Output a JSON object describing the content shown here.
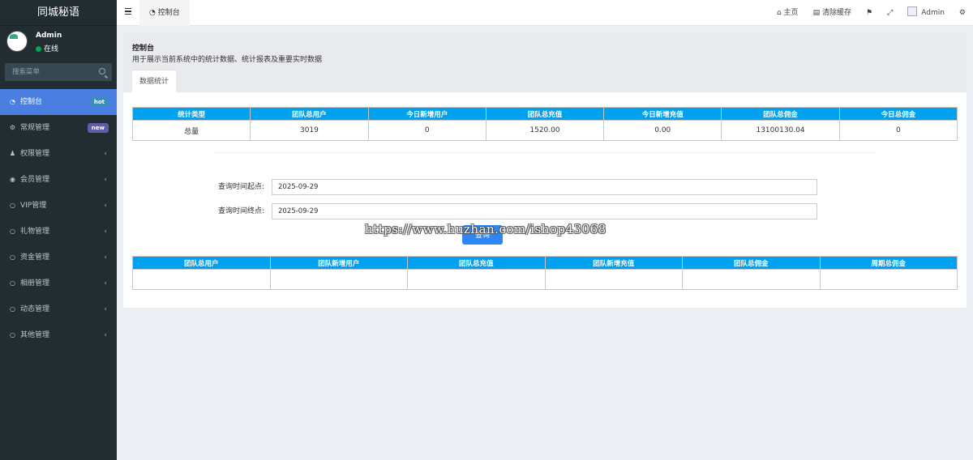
{
  "sidebar": {
    "app_title": "同城秘语",
    "user": {
      "name": "Admin",
      "status": "在线"
    },
    "search_placeholder": "搜索菜单",
    "items": [
      {
        "icon": "dashboard-icon",
        "label": "控制台",
        "badge": "hot",
        "active": true
      },
      {
        "icon": "gears-icon",
        "label": "常规管理",
        "badge": "new"
      },
      {
        "icon": "users-icon",
        "label": "权限管理"
      },
      {
        "icon": "user-circle-icon",
        "label": "会员管理"
      },
      {
        "icon": "circle-icon",
        "label": "VIP管理"
      },
      {
        "icon": "circle-icon",
        "label": "礼物管理"
      },
      {
        "icon": "circle-icon",
        "label": "资金管理"
      },
      {
        "icon": "circle-icon",
        "label": "相册管理"
      },
      {
        "icon": "circle-icon",
        "label": "动态管理"
      },
      {
        "icon": "circle-icon",
        "label": "其他管理"
      }
    ]
  },
  "header": {
    "tab_label": "控制台",
    "nav": {
      "home": "主页",
      "clear_cache": "清除缓存",
      "admin": "Admin"
    }
  },
  "content_header": {
    "title": "控制台",
    "description": "用于展示当前系统中的统计数据、统计报表及重要实时数据"
  },
  "tabs": {
    "stats": "数据统计"
  },
  "stats_table": {
    "headers": [
      "统计类型",
      "团队总用户",
      "今日新增用户",
      "团队总充值",
      "今日新增充值",
      "团队总佣金",
      "今日总佣金"
    ],
    "row": [
      "总量",
      "3019",
      "0",
      "1520.00",
      "0.00",
      "13100130.04",
      "0"
    ]
  },
  "query_form": {
    "start_label": "查询时间起点:",
    "start_value": "2025-09-29",
    "end_label": "查询时间终点:",
    "end_value": "2025-09-29",
    "button": "查询"
  },
  "period_table": {
    "headers": [
      "团队总用户",
      "团队新增用户",
      "团队总充值",
      "团队新增充值",
      "团队总佣金",
      "周期总佣金"
    ],
    "row": [
      "",
      "",
      "",
      "",
      "",
      ""
    ]
  },
  "watermark": "https://www.huzhan.com/ishop43068",
  "colors": {
    "sidebar_bg": "#222d32",
    "active_item": "#4a7ee0",
    "table_header": "#00a2f0",
    "query_button": "#2e86f5"
  }
}
